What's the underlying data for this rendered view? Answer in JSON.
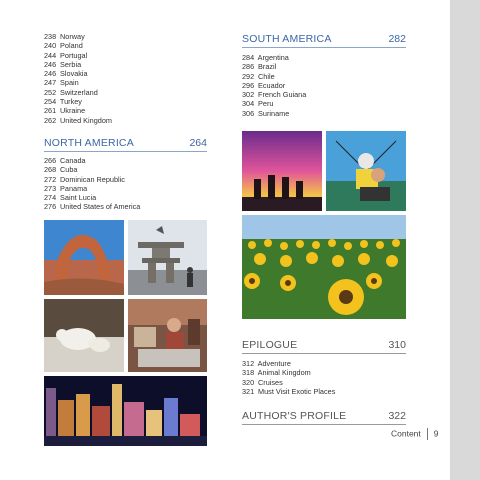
{
  "europe_entries": [
    {
      "page": "238",
      "name": "Norway"
    },
    {
      "page": "240",
      "name": "Poland"
    },
    {
      "page": "244",
      "name": "Portugal"
    },
    {
      "page": "246",
      "name": "Serbia"
    },
    {
      "page": "246",
      "name": "Slovakia"
    },
    {
      "page": "247",
      "name": "Spain"
    },
    {
      "page": "252",
      "name": "Switzerland"
    },
    {
      "page": "254",
      "name": "Turkey"
    },
    {
      "page": "261",
      "name": "Ukraine"
    },
    {
      "page": "262",
      "name": "United Kingdom"
    }
  ],
  "north_america": {
    "title": "NORTH AMERICA",
    "page": "264",
    "entries": [
      {
        "page": "266",
        "name": "Canada"
      },
      {
        "page": "268",
        "name": "Cuba"
      },
      {
        "page": "272",
        "name": "Dominican Republic"
      },
      {
        "page": "273",
        "name": "Panama"
      },
      {
        "page": "274",
        "name": "Saint Lucia"
      },
      {
        "page": "276",
        "name": "United States of America"
      }
    ]
  },
  "south_america": {
    "title": "SOUTH AMERICA",
    "page": "282",
    "entries": [
      {
        "page": "284",
        "name": "Argentina"
      },
      {
        "page": "286",
        "name": "Brazil"
      },
      {
        "page": "292",
        "name": "Chile"
      },
      {
        "page": "296",
        "name": "Ecuador"
      },
      {
        "page": "302",
        "name": "French Guiana"
      },
      {
        "page": "304",
        "name": "Peru"
      },
      {
        "page": "306",
        "name": "Suriname"
      }
    ]
  },
  "epilogue": {
    "title": "EPILOGUE",
    "page": "310",
    "entries": [
      {
        "page": "312",
        "name": "Adventure"
      },
      {
        "page": "318",
        "name": "Animal Kingdom"
      },
      {
        "page": "320",
        "name": "Cruises"
      },
      {
        "page": "321",
        "name": "Must Visit Exotic Places"
      }
    ]
  },
  "authors_profile": {
    "title": "AUTHOR'S PROFILE",
    "page": "322"
  },
  "footer": {
    "label": "Content",
    "page_number": "9"
  },
  "colors": {
    "accent_blue": "#3b66a5",
    "sidebar_gray": "#d9d9d9"
  }
}
